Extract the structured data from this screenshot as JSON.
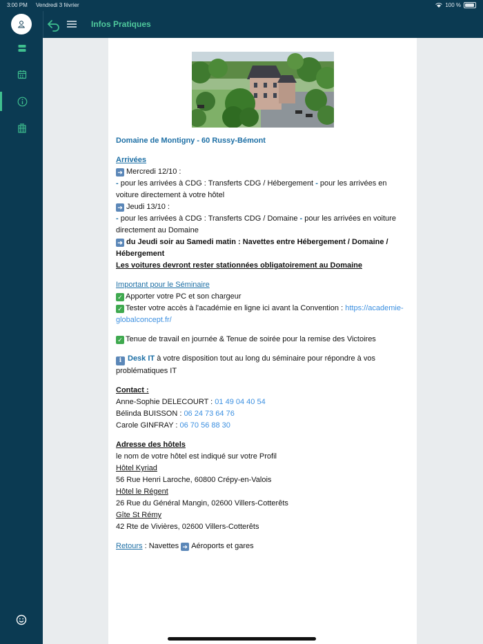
{
  "status": {
    "time": "3:00 PM",
    "date": "Vendredi 3 février",
    "battery": "100 %"
  },
  "sidebar": {
    "icons": [
      "user-icon",
      "layers-icon",
      "calendar-icon",
      "info-icon",
      "hotel-icon",
      "smiley-icon"
    ],
    "active": "info-icon",
    "accent": "#3fbf8f",
    "background": "#0b3a52"
  },
  "header": {
    "title": "Infos Pratiques",
    "title_color": "#4fc99c"
  },
  "content": {
    "venue": "Domaine de Montigny - 60 Russy-Bémont",
    "arrivals": {
      "title": "Arrivées",
      "day1": "Mercredi 12/10 :",
      "day1_cdg": "pour les arrivées à CDG : Transferts CDG / Hébergement",
      "day1_car": "pour les arrivées en voiture directement à votre hôtel",
      "day2": "Jeudi 13/10 :",
      "day2_cdg": "pour les arrivées à CDG : Transferts CDG / Domaine",
      "day2_car": "pour les arrivées en voiture directement au Domaine",
      "shuttle": "du Jeudi soir au Samedi matin : Navettes entre Hébergement / Domaine / Hébergement",
      "parking": "Les voitures devront rester stationnées obligatoirement au Domaine"
    },
    "seminar": {
      "title": "Important pour le Séminaire",
      "item1": "Apporter votre PC et son chargeur",
      "item2": "Tester votre accès à l'académie en ligne ici avant la Convention :",
      "item2_link": "https://academie-globalconcept.fr/",
      "item3": "Tenue de travail en journée & Tenue de soirée pour la remise des Victoires",
      "desk_label": "Desk IT",
      "desk_text": "à votre disposition tout au long du séminaire pour répondre à vos problématiques IT"
    },
    "contact": {
      "title": "Contact :",
      "people": [
        {
          "name": "Anne-Sophie DELECOURT :",
          "phone": "01 49 04 40 54"
        },
        {
          "name": "Bélinda BUISSON :",
          "phone": "06 24 73 64 76"
        },
        {
          "name": "Carole GINFRAY :",
          "phone": "06 70 56 88 30"
        }
      ]
    },
    "hotels": {
      "title": "Adresse des hôtels",
      "intro": "le nom de votre hôtel est indiqué sur votre Profil",
      "list": [
        {
          "name": "Hôtel Kyriad",
          "address": "56 Rue Henri Laroche, 60800 Crépy-en-Valois"
        },
        {
          "name": "Hôtel le Régent",
          "address": "26 Rue du Général Mangin, 02600 Villers-Cotterêts"
        },
        {
          "name": "Gîte St Rémy",
          "address": "42 Rte de Vivières, 02600 Villers-Cotterêts"
        }
      ]
    },
    "returns": {
      "link": "Retours",
      "text1": ": Navettes",
      "text2": "Aéroports et gares"
    }
  }
}
